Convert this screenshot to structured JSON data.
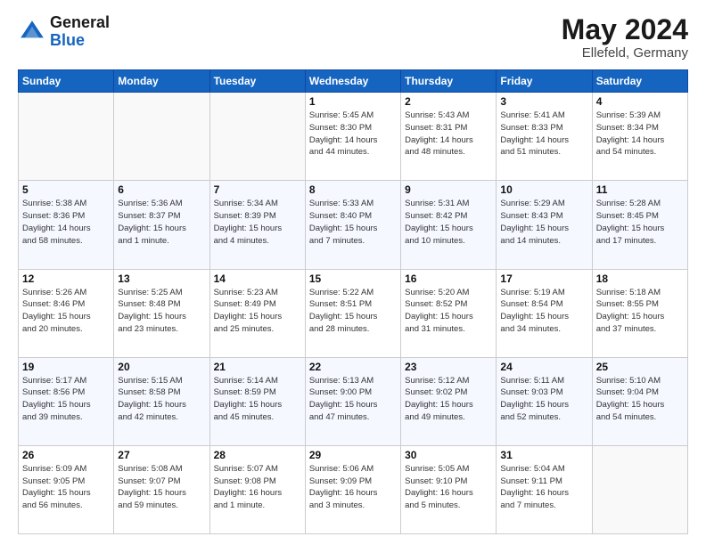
{
  "header": {
    "logo_general": "General",
    "logo_blue": "Blue",
    "month_title": "May 2024",
    "location": "Ellefeld, Germany"
  },
  "days_of_week": [
    "Sunday",
    "Monday",
    "Tuesday",
    "Wednesday",
    "Thursday",
    "Friday",
    "Saturday"
  ],
  "weeks": [
    [
      {
        "day": "",
        "info": []
      },
      {
        "day": "",
        "info": []
      },
      {
        "day": "",
        "info": []
      },
      {
        "day": "1",
        "info": [
          "Sunrise: 5:45 AM",
          "Sunset: 8:30 PM",
          "Daylight: 14 hours",
          "and 44 minutes."
        ]
      },
      {
        "day": "2",
        "info": [
          "Sunrise: 5:43 AM",
          "Sunset: 8:31 PM",
          "Daylight: 14 hours",
          "and 48 minutes."
        ]
      },
      {
        "day": "3",
        "info": [
          "Sunrise: 5:41 AM",
          "Sunset: 8:33 PM",
          "Daylight: 14 hours",
          "and 51 minutes."
        ]
      },
      {
        "day": "4",
        "info": [
          "Sunrise: 5:39 AM",
          "Sunset: 8:34 PM",
          "Daylight: 14 hours",
          "and 54 minutes."
        ]
      }
    ],
    [
      {
        "day": "5",
        "info": [
          "Sunrise: 5:38 AM",
          "Sunset: 8:36 PM",
          "Daylight: 14 hours",
          "and 58 minutes."
        ]
      },
      {
        "day": "6",
        "info": [
          "Sunrise: 5:36 AM",
          "Sunset: 8:37 PM",
          "Daylight: 15 hours",
          "and 1 minute."
        ]
      },
      {
        "day": "7",
        "info": [
          "Sunrise: 5:34 AM",
          "Sunset: 8:39 PM",
          "Daylight: 15 hours",
          "and 4 minutes."
        ]
      },
      {
        "day": "8",
        "info": [
          "Sunrise: 5:33 AM",
          "Sunset: 8:40 PM",
          "Daylight: 15 hours",
          "and 7 minutes."
        ]
      },
      {
        "day": "9",
        "info": [
          "Sunrise: 5:31 AM",
          "Sunset: 8:42 PM",
          "Daylight: 15 hours",
          "and 10 minutes."
        ]
      },
      {
        "day": "10",
        "info": [
          "Sunrise: 5:29 AM",
          "Sunset: 8:43 PM",
          "Daylight: 15 hours",
          "and 14 minutes."
        ]
      },
      {
        "day": "11",
        "info": [
          "Sunrise: 5:28 AM",
          "Sunset: 8:45 PM",
          "Daylight: 15 hours",
          "and 17 minutes."
        ]
      }
    ],
    [
      {
        "day": "12",
        "info": [
          "Sunrise: 5:26 AM",
          "Sunset: 8:46 PM",
          "Daylight: 15 hours",
          "and 20 minutes."
        ]
      },
      {
        "day": "13",
        "info": [
          "Sunrise: 5:25 AM",
          "Sunset: 8:48 PM",
          "Daylight: 15 hours",
          "and 23 minutes."
        ]
      },
      {
        "day": "14",
        "info": [
          "Sunrise: 5:23 AM",
          "Sunset: 8:49 PM",
          "Daylight: 15 hours",
          "and 25 minutes."
        ]
      },
      {
        "day": "15",
        "info": [
          "Sunrise: 5:22 AM",
          "Sunset: 8:51 PM",
          "Daylight: 15 hours",
          "and 28 minutes."
        ]
      },
      {
        "day": "16",
        "info": [
          "Sunrise: 5:20 AM",
          "Sunset: 8:52 PM",
          "Daylight: 15 hours",
          "and 31 minutes."
        ]
      },
      {
        "day": "17",
        "info": [
          "Sunrise: 5:19 AM",
          "Sunset: 8:54 PM",
          "Daylight: 15 hours",
          "and 34 minutes."
        ]
      },
      {
        "day": "18",
        "info": [
          "Sunrise: 5:18 AM",
          "Sunset: 8:55 PM",
          "Daylight: 15 hours",
          "and 37 minutes."
        ]
      }
    ],
    [
      {
        "day": "19",
        "info": [
          "Sunrise: 5:17 AM",
          "Sunset: 8:56 PM",
          "Daylight: 15 hours",
          "and 39 minutes."
        ]
      },
      {
        "day": "20",
        "info": [
          "Sunrise: 5:15 AM",
          "Sunset: 8:58 PM",
          "Daylight: 15 hours",
          "and 42 minutes."
        ]
      },
      {
        "day": "21",
        "info": [
          "Sunrise: 5:14 AM",
          "Sunset: 8:59 PM",
          "Daylight: 15 hours",
          "and 45 minutes."
        ]
      },
      {
        "day": "22",
        "info": [
          "Sunrise: 5:13 AM",
          "Sunset: 9:00 PM",
          "Daylight: 15 hours",
          "and 47 minutes."
        ]
      },
      {
        "day": "23",
        "info": [
          "Sunrise: 5:12 AM",
          "Sunset: 9:02 PM",
          "Daylight: 15 hours",
          "and 49 minutes."
        ]
      },
      {
        "day": "24",
        "info": [
          "Sunrise: 5:11 AM",
          "Sunset: 9:03 PM",
          "Daylight: 15 hours",
          "and 52 minutes."
        ]
      },
      {
        "day": "25",
        "info": [
          "Sunrise: 5:10 AM",
          "Sunset: 9:04 PM",
          "Daylight: 15 hours",
          "and 54 minutes."
        ]
      }
    ],
    [
      {
        "day": "26",
        "info": [
          "Sunrise: 5:09 AM",
          "Sunset: 9:05 PM",
          "Daylight: 15 hours",
          "and 56 minutes."
        ]
      },
      {
        "day": "27",
        "info": [
          "Sunrise: 5:08 AM",
          "Sunset: 9:07 PM",
          "Daylight: 15 hours",
          "and 59 minutes."
        ]
      },
      {
        "day": "28",
        "info": [
          "Sunrise: 5:07 AM",
          "Sunset: 9:08 PM",
          "Daylight: 16 hours",
          "and 1 minute."
        ]
      },
      {
        "day": "29",
        "info": [
          "Sunrise: 5:06 AM",
          "Sunset: 9:09 PM",
          "Daylight: 16 hours",
          "and 3 minutes."
        ]
      },
      {
        "day": "30",
        "info": [
          "Sunrise: 5:05 AM",
          "Sunset: 9:10 PM",
          "Daylight: 16 hours",
          "and 5 minutes."
        ]
      },
      {
        "day": "31",
        "info": [
          "Sunrise: 5:04 AM",
          "Sunset: 9:11 PM",
          "Daylight: 16 hours",
          "and 7 minutes."
        ]
      },
      {
        "day": "",
        "info": []
      }
    ]
  ]
}
